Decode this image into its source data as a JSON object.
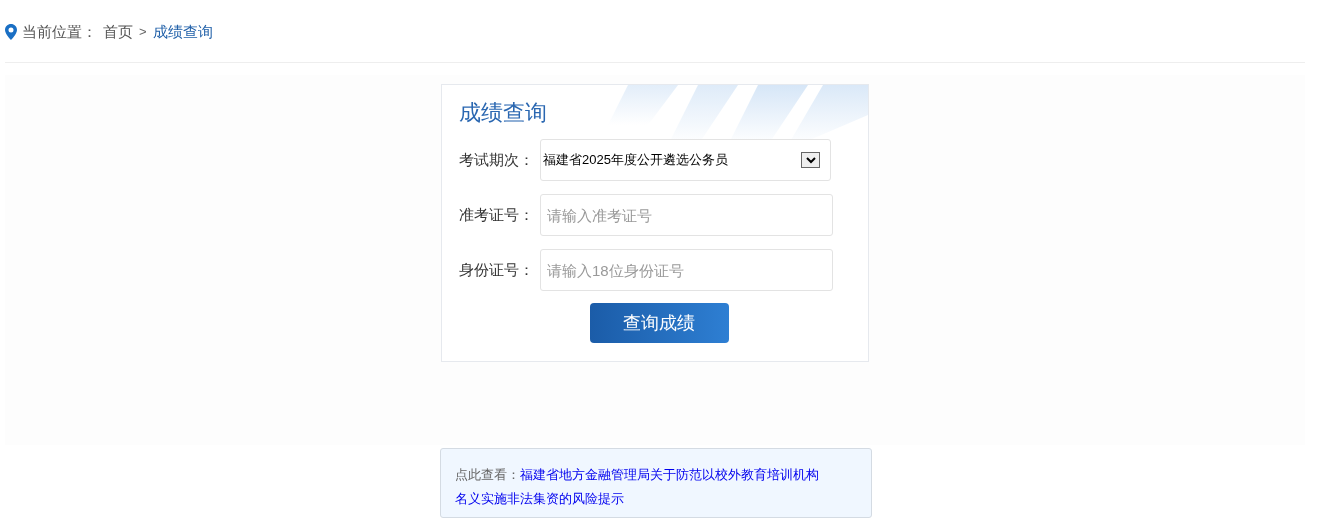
{
  "breadcrumb": {
    "label": "当前位置：",
    "items": [
      {
        "text": "首页",
        "current": false
      },
      {
        "text": "成绩查询",
        "current": true
      }
    ],
    "separator": ">"
  },
  "card": {
    "title": "成绩查询",
    "fields": [
      {
        "kind": "select",
        "label": "考试期次：",
        "value": "福建省2025年度公开遴选公务员"
      },
      {
        "kind": "input",
        "label": "准考证号：",
        "placeholder": "请输入准考证号"
      },
      {
        "kind": "input",
        "label": "身份证号：",
        "placeholder": "请输入18位身份证号"
      }
    ],
    "button": "查询成绩"
  },
  "notice": {
    "label": "点此查看：",
    "link_lines": [
      "福建省地方金融管理局关于防范以校外教育培训机构",
      "名义实施非法集资的风险提示"
    ]
  }
}
